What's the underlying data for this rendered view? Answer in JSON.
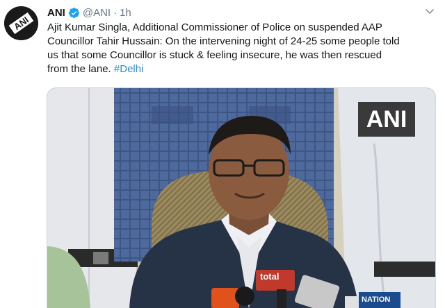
{
  "tweet": {
    "display_name": "ANI",
    "handle": "@ANI",
    "separator": "·",
    "time": "1h",
    "text_lines": [
      "Ajit Kumar Singla, Additional Commissioner of Police on suspended AAP",
      "Councillor Tahir Hussain: On the intervening night of 24-25 some people told",
      "us that some Councillor is stuck & feeling insecure, he was then rescued",
      "from the lane. "
    ],
    "hashtag": "#Delhi",
    "avatar_icon": "ani-logo-icon",
    "verified_icon": "verified-badge-icon",
    "menu_icon": "chevron-down-icon"
  },
  "media": {
    "watermark": "ANI",
    "mic_labels": {
      "left": "total",
      "right": "NATION"
    }
  },
  "colors": {
    "link": "#1b95e0",
    "secondary_text": "#657786",
    "verified": "#1da1f2"
  }
}
